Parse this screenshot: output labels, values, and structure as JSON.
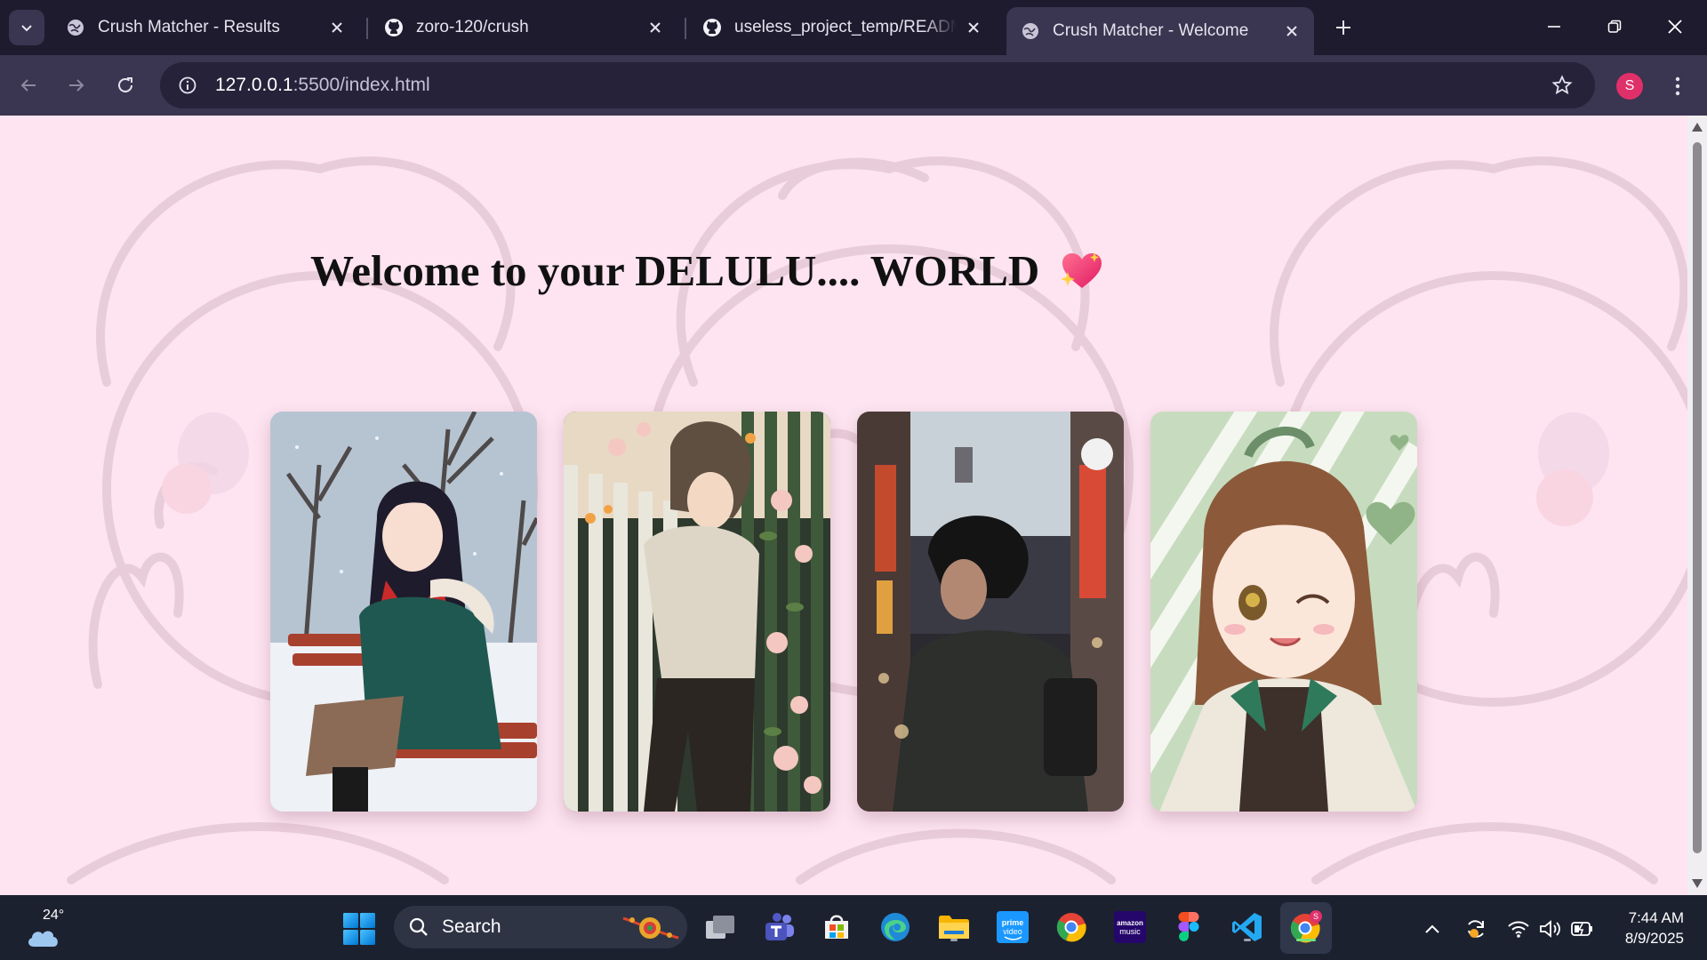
{
  "browser": {
    "tabs": [
      {
        "title": "Crush Matcher - Results",
        "favicon": "globe-icon",
        "active": false
      },
      {
        "title": "zoro-120/crush",
        "favicon": "github-icon",
        "active": false
      },
      {
        "title": "useless_project_temp/README.",
        "favicon": "github-icon",
        "active": false
      },
      {
        "title": "Crush Matcher - Welcome",
        "favicon": "globe-icon",
        "active": true
      }
    ],
    "url_host": "127.0.0.1",
    "url_rest": ":5500/index.html",
    "profile_initial": "S"
  },
  "page": {
    "title": "Welcome to your DELULU.... WORLD",
    "title_emoji": "sparkling-heart-icon",
    "cards": [
      {
        "name": "anime-girl-winter-bench"
      },
      {
        "name": "anime-boy-flower-fence"
      },
      {
        "name": "anime-boy-city-street"
      },
      {
        "name": "anime-girl-winking"
      }
    ],
    "background_color": "#fde4f0"
  },
  "taskbar": {
    "weather_temp": "24°",
    "search_label": "Search",
    "time": "7:44 AM",
    "date": "8/9/2025"
  }
}
